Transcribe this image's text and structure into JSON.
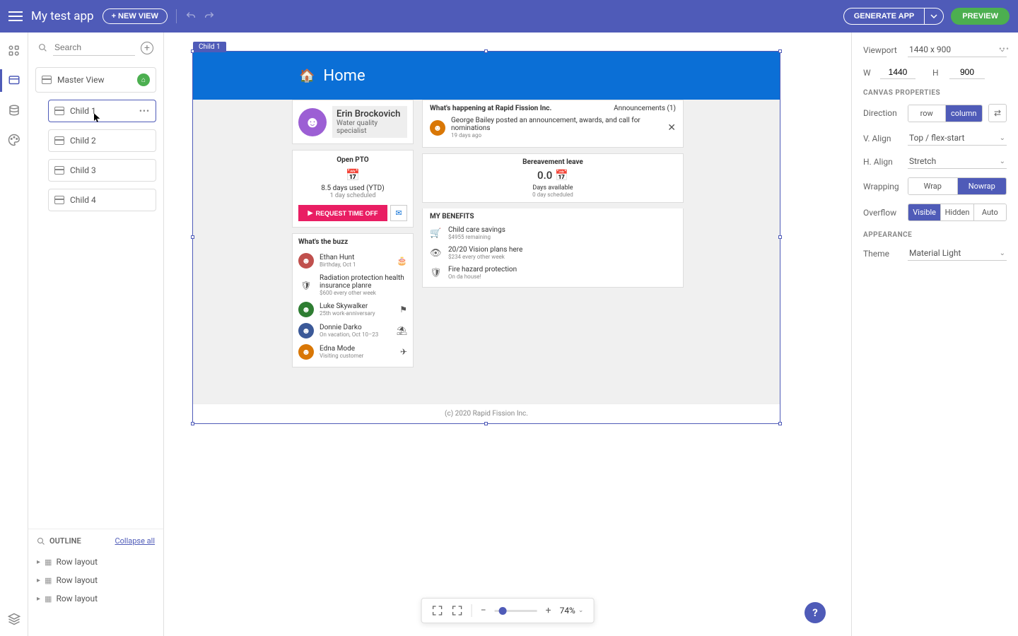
{
  "topbar": {
    "app_title": "My test app",
    "new_view": "+ NEW VIEW",
    "generate_app": "GENERATE APP",
    "preview": "PREVIEW"
  },
  "sidebar": {
    "search_placeholder": "Search",
    "master_view": "Master View",
    "children": [
      "Child 1",
      "Child 2",
      "Child 3",
      "Child 4"
    ],
    "selected_child": "Child 1"
  },
  "outline": {
    "title": "OUTLINE",
    "collapse_all": "Collapse all",
    "items": [
      "Row layout",
      "Row layout",
      "Row layout"
    ]
  },
  "canvas": {
    "selection_label": "Child 1",
    "home_label": "Home",
    "profile": {
      "name": "Erin Brockovich",
      "title": "Water quality specialist"
    },
    "pto": {
      "title": "Open PTO",
      "used": "8.5 days used (YTD)",
      "scheduled": "1 day scheduled",
      "request": "REQUEST TIME OFF"
    },
    "buzz": {
      "title": "What's the buzz",
      "items": [
        {
          "name": "Ethan Hunt",
          "sub": "Birthday, Oct 1",
          "icon": "🎂",
          "color": "#c0504d"
        },
        {
          "name": "Radiation protection health insurance planre",
          "sub": "$600 every other week",
          "icon": "",
          "shield": true
        },
        {
          "name": "Luke Skywalker",
          "sub": "25th work-anniversary",
          "icon": "⚑",
          "color": "#2e7d32"
        },
        {
          "name": "Donnie Darko",
          "sub": "On vacation, Oct 10–23",
          "icon": "⛱",
          "color": "#3b5998"
        },
        {
          "name": "Edna Mode",
          "sub": "Visiting customer",
          "icon": "✈",
          "color": "#d97706"
        }
      ]
    },
    "announce": {
      "title": "What's happening at Rapid Fission Inc.",
      "count": "Announcements (1)",
      "item": {
        "text": "George Bailey posted an announcement, awards, and call for nominations",
        "age": "19 days ago"
      }
    },
    "bereave": {
      "title": "Bereavement leave",
      "num": "0.0",
      "label": "Days available",
      "sched": "0 day scheduled"
    },
    "benefits": {
      "title": "MY BENEFITS",
      "items": [
        {
          "icon": "🛒",
          "name": "Child care savings",
          "sub": "$4955 remaining"
        },
        {
          "icon": "👁",
          "name": "20/20 Vision plans here",
          "sub": "$234 every other week"
        },
        {
          "icon": "🛡",
          "name": "Fire hazard protection",
          "sub": "On da house!"
        }
      ]
    },
    "footer": "(c) 2020 Rapid Fission Inc."
  },
  "zoom": {
    "value": "74%"
  },
  "right": {
    "viewport_label": "Viewport",
    "viewport_value": "1440 x 900",
    "w_label": "W",
    "w_value": "1440",
    "h_label": "H",
    "h_value": "900",
    "canvas_properties": "CANVAS PROPERTIES",
    "direction_label": "Direction",
    "dir_row": "row",
    "dir_column": "column",
    "valign_label": "V. Align",
    "valign_value": "Top / flex-start",
    "halign_label": "H. Align",
    "halign_value": "Stretch",
    "wrap_label": "Wrapping",
    "wrap": "Wrap",
    "nowrap": "Nowrap",
    "overflow_label": "Overflow",
    "ov_visible": "Visible",
    "ov_hidden": "Hidden",
    "ov_auto": "Auto",
    "appearance": "APPEARANCE",
    "theme_label": "Theme",
    "theme_value": "Material Light"
  }
}
